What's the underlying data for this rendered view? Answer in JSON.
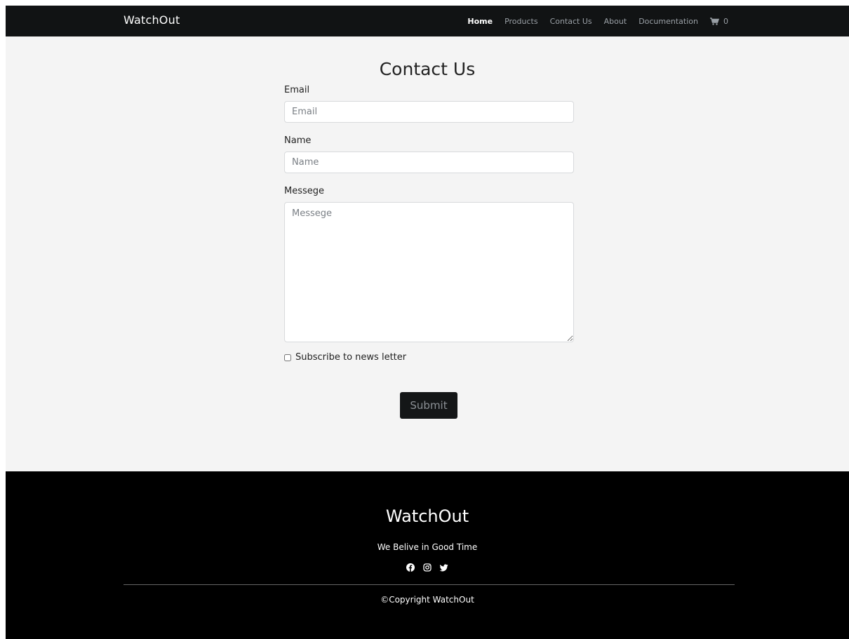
{
  "navbar": {
    "brand": "WatchOut",
    "links": [
      "Home",
      "Products",
      "Contact Us",
      "About",
      "Documentation"
    ],
    "active_link": "Home",
    "cart_icon": "cart-icon",
    "cart_count": "0"
  },
  "contact": {
    "title": "Contact Us",
    "email_label": "Email",
    "email_placeholder": "Email",
    "name_label": "Name",
    "name_placeholder": "Name",
    "message_label": "Messege",
    "message_placeholder": "Messege",
    "subscribe_label": "Subscribe to news letter",
    "subscribe_checked": false,
    "submit_label": "Submit"
  },
  "footer": {
    "brand": "WatchOut",
    "tagline": "We Belive in Good Time",
    "social_icons": [
      "facebook-icon",
      "instagram-icon",
      "twitter-icon"
    ],
    "copyright": "©Copyright WatchOut"
  },
  "colors": {
    "navbar_bg": "#111314",
    "page_bg": "#f4f4f4",
    "footer_bg": "#000000",
    "button_bg": "#141617"
  }
}
